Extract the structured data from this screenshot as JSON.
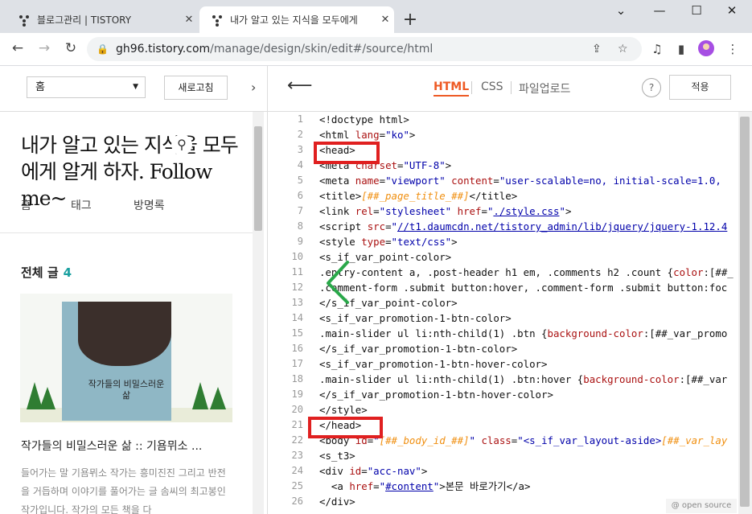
{
  "browser": {
    "tabs": [
      {
        "title": "블로그관리 | TISTORY"
      },
      {
        "title": "내가 알고 있는 지식을 모두에게"
      }
    ],
    "url_host": "gh96.tistory.com",
    "url_path": "/manage/design/skin/edit#/source/html"
  },
  "left": {
    "select_value": "홈",
    "refresh_label": "새로고침",
    "blog_title": "내가 알고 있는 지식을 모두에게 알게 하자. Follow me~",
    "nav": [
      "홈",
      "태그",
      "방명록"
    ],
    "all_posts_label": "전체 글",
    "all_posts_count": "4",
    "book_title": "작가들의 비밀스러운 삶",
    "post_title": "작가들의 비밀스러운 삶 :: 기욤뮈소 ...",
    "post_excerpt": "들어가는 말 기욤뮈소 작가는 흥미진진 그리고 반전을 거듭하며 이야기를 풀어가는 글 솜씨의 최고봉인 작가입니다. 작가의 모든 책을 다"
  },
  "editor": {
    "tabs": [
      "HTML",
      "CSS",
      "파일업로드"
    ],
    "active_tab": "HTML",
    "help": "?",
    "apply_label": "적용",
    "line_numbers": [
      "1",
      "2",
      "3",
      "4",
      "5",
      "6",
      "7",
      "8",
      "9",
      "10",
      "11",
      "12",
      "13",
      "14",
      "15",
      "16",
      "17",
      "18",
      "19",
      "20",
      "21",
      "22",
      "23",
      "24",
      "25",
      "26"
    ],
    "footer": "@ open source"
  },
  "colors": {
    "accent": "#ee5a24",
    "highlight_box": "#e02020",
    "arrow": "#2aa84a"
  }
}
